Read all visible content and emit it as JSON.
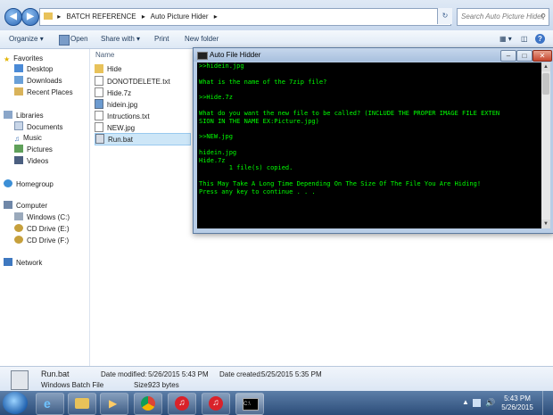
{
  "explorer": {
    "breadcrumb": [
      "BATCH REFERENCE",
      "Auto Picture Hider"
    ],
    "search_placeholder": "Search Auto Picture Hider",
    "toolbar": {
      "organize": "Organize",
      "open": "Open",
      "share_with": "Share with",
      "print": "Print",
      "new_folder": "New folder"
    },
    "nav": {
      "favorites": "Favorites",
      "desktop": "Desktop",
      "downloads": "Downloads",
      "recent_places": "Recent Places",
      "libraries": "Libraries",
      "documents": "Documents",
      "music": "Music",
      "pictures": "Pictures",
      "videos": "Videos",
      "homegroup": "Homegroup",
      "computer": "Computer",
      "windows_c": "Windows (C:)",
      "cd_e": "CD Drive (E:)",
      "cd_f": "CD Drive (F:)",
      "network": "Network"
    },
    "column_name": "Name",
    "files": [
      {
        "name": "Hide"
      },
      {
        "name": "DONOTDELETE.txt"
      },
      {
        "name": "Hide.7z"
      },
      {
        "name": "hidein.jpg"
      },
      {
        "name": "Intructions.txt"
      },
      {
        "name": "NEW.jpg"
      },
      {
        "name": "Run.bat"
      }
    ]
  },
  "cmd": {
    "title": "Auto File Hidder",
    "lines": [
      ">>hidein.jpg",
      "",
      "What is the name of the 7zip file?",
      "",
      ">>Hide.7z",
      "",
      "What do you want the new file to be called? (INCLUDE THE PROPER IMAGE FILE EXTEN",
      "SION IN THE NAME EX:Picture.jpg)",
      "",
      ">>NEW.jpg",
      "",
      "hidein.jpg",
      "Hide.7z",
      "        1 file(s) copied.",
      "",
      "This May Take A Long Time Depending On The Size Of The File You Are Hiding!",
      "Press any key to continue . . ."
    ]
  },
  "details": {
    "filename": "Run.bat",
    "type": "Windows Batch File",
    "modified_label": "Date modified:",
    "modified": "5/26/2015 5:43 PM",
    "created_label": "Date created:",
    "created": "5/25/2015 5:35 PM",
    "size_label": "Size:",
    "size": "923 bytes"
  },
  "taskbar": {
    "time": "5:43 PM",
    "date": "5/26/2015"
  },
  "colors": {
    "console_text": "#00ff00",
    "console_bg": "#000000",
    "selection": "#cde6f7"
  }
}
